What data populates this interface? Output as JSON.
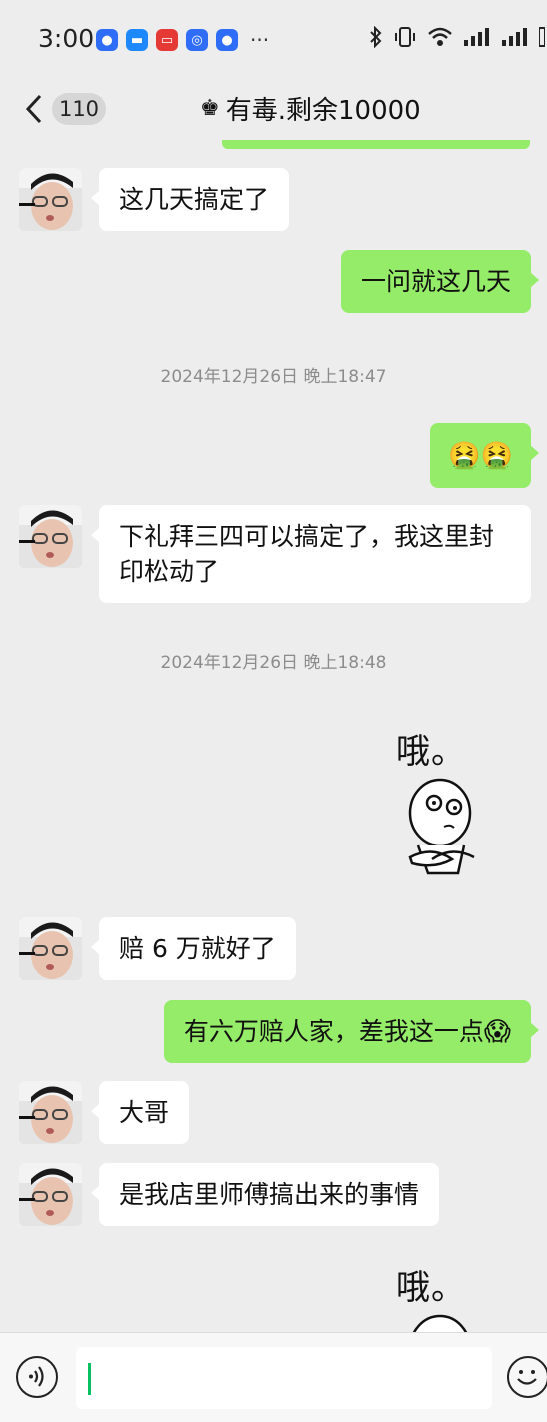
{
  "status_bar": {
    "time": "3:00",
    "more": "···",
    "apps": [
      {
        "icon": "baidu-icon",
        "color": "#2f6df6"
      },
      {
        "icon": "message-icon",
        "color": "#1e88ff"
      },
      {
        "icon": "video-icon",
        "color": "#e53935"
      },
      {
        "icon": "browser-icon",
        "color": "#2f6df6"
      },
      {
        "icon": "baidu-icon",
        "color": "#2f6df6"
      }
    ]
  },
  "header": {
    "unread_count": "110",
    "title": "有毒.剩余10000",
    "title_icon": "crown-icon"
  },
  "messages": [
    {
      "side": "in",
      "type": "text",
      "text": "这几天搞定了"
    },
    {
      "side": "out",
      "type": "text",
      "text": "一问就这几天"
    },
    {
      "type": "time",
      "text": "2024年12月26日 晚上18:47"
    },
    {
      "side": "out",
      "type": "emoji",
      "text": "🤮🤮"
    },
    {
      "side": "in",
      "type": "text",
      "text": "下礼拜三四可以搞定了，我这里封印松动了"
    },
    {
      "type": "time",
      "text": "2024年12月26日 晚上18:48"
    },
    {
      "side": "out",
      "type": "sticker",
      "text": "哦。"
    },
    {
      "side": "in",
      "type": "text",
      "text": "赔 6 万就好了"
    },
    {
      "side": "out",
      "type": "text",
      "text": "有六万赔人家，差我这一点",
      "emoji": "😱"
    },
    {
      "side": "in",
      "type": "text",
      "text": "大哥"
    },
    {
      "side": "in",
      "type": "text",
      "text": "是我店里师傅搞出来的事情"
    },
    {
      "side": "out",
      "type": "sticker",
      "text": "哦。"
    }
  ],
  "colors": {
    "background": "#ededed",
    "bubble_out": "#95ec69",
    "bubble_in": "#ffffff",
    "timestamp": "#8c8c8c",
    "caret": "#07c160"
  },
  "input_bar": {
    "value": ""
  }
}
